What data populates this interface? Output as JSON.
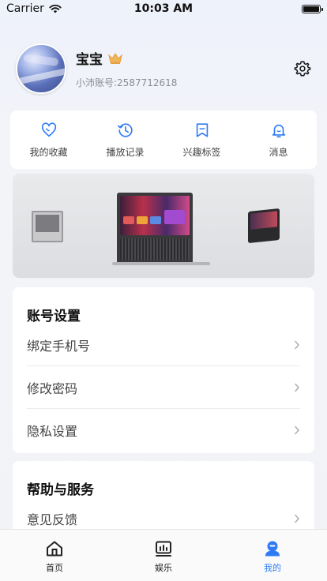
{
  "status_bar": {
    "carrier": "Carrier",
    "time": "10:03 AM"
  },
  "profile": {
    "name": "宝宝",
    "account": "小沛账号:2587712618"
  },
  "quick_actions": [
    {
      "label": "我的收藏",
      "icon": "heart-icon"
    },
    {
      "label": "播放记录",
      "icon": "history-icon"
    },
    {
      "label": "兴趣标签",
      "icon": "bookmark-icon"
    },
    {
      "label": "消息",
      "icon": "bell-icon"
    }
  ],
  "account_settings": {
    "title": "账号设置",
    "items": [
      "绑定手机号",
      "修改密码",
      "隐私设置"
    ]
  },
  "help_service": {
    "title": "帮助与服务",
    "items": [
      "意见反馈"
    ]
  },
  "tabs": [
    {
      "label": "首页",
      "icon": "home-icon"
    },
    {
      "label": "娱乐",
      "icon": "entertainment-icon"
    },
    {
      "label": "我的",
      "icon": "profile-icon",
      "active": true
    }
  ],
  "colors": {
    "accent": "#2f7bf5",
    "crown": "#f0b45a"
  }
}
